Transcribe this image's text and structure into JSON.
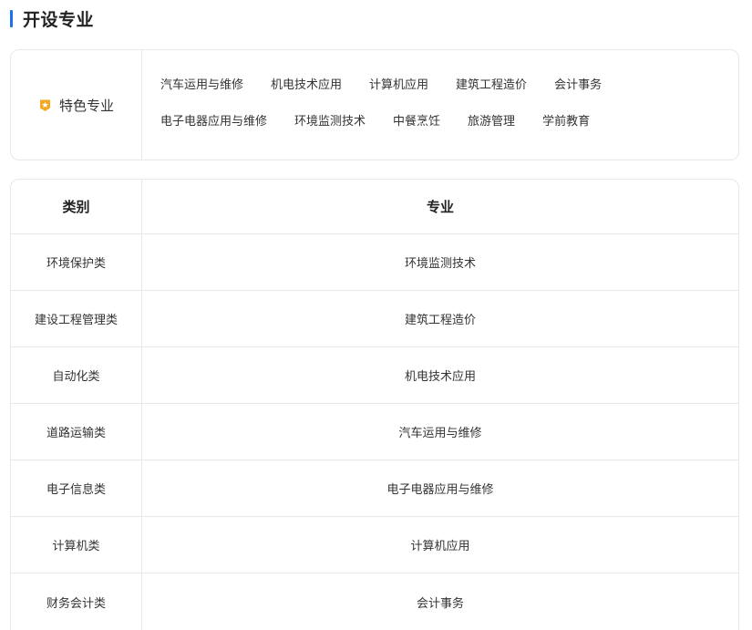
{
  "section": {
    "title": "开设专业"
  },
  "featured": {
    "label": "特色专业",
    "items": [
      "汽车运用与维修",
      "机电技术应用",
      "计算机应用",
      "建筑工程造价",
      "会计事务",
      "电子电器应用与维修",
      "环境监测技术",
      "中餐烹饪",
      "旅游管理",
      "学前教育"
    ]
  },
  "table": {
    "headers": {
      "category": "类别",
      "major": "专业"
    },
    "rows": [
      {
        "category": "环境保护类",
        "major": "环境监测技术"
      },
      {
        "category": "建设工程管理类",
        "major": "建筑工程造价"
      },
      {
        "category": "自动化类",
        "major": "机电技术应用"
      },
      {
        "category": "道路运输类",
        "major": "汽车运用与维修"
      },
      {
        "category": "电子信息类",
        "major": "电子电器应用与维修"
      },
      {
        "category": "计算机类",
        "major": "计算机应用"
      },
      {
        "category": "财务会计类",
        "major": "会计事务"
      }
    ]
  },
  "colors": {
    "accent": "#1a73e8",
    "badge": "#f5a623"
  },
  "icons": {
    "featured": "star-badge-icon"
  }
}
